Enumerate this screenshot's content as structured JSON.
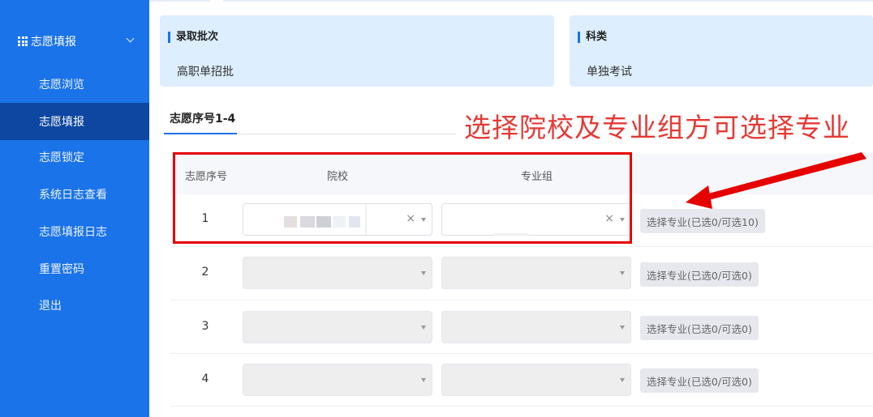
{
  "sidebar": {
    "header_label": "志愿填报",
    "items": [
      {
        "label": "志愿浏览"
      },
      {
        "label": "志愿填报"
      },
      {
        "label": "志愿锁定"
      },
      {
        "label": "系统日志查看"
      },
      {
        "label": "志愿填报日志"
      },
      {
        "label": "重置密码"
      },
      {
        "label": "退出"
      }
    ],
    "active_index": 1
  },
  "info_cards": [
    {
      "title": "录取批次",
      "value": "高职单招批"
    },
    {
      "title": "科类",
      "value": "单独考试"
    }
  ],
  "tab": {
    "label": "志愿序号1-4"
  },
  "annotation": {
    "text": "选择院校及专业组方可选择专业"
  },
  "table": {
    "headers": {
      "index": "志愿序号",
      "school": "院校",
      "group": "专业组"
    },
    "rows": [
      {
        "index": "1",
        "button_label": "选择专业(已选0/可选10)",
        "enabled": true
      },
      {
        "index": "2",
        "button_label": "选择专业(已选0/可选0)",
        "enabled": false
      },
      {
        "index": "3",
        "button_label": "选择专业(已选0/可选0)",
        "enabled": false
      },
      {
        "index": "4",
        "button_label": "选择专业(已选0/可选0)",
        "enabled": false
      }
    ],
    "clear_glyph": "×"
  },
  "colors": {
    "sidebar_bg": "#1a73e8",
    "sidebar_active": "#0d47a1",
    "card_bg": "#ddeefe",
    "annotation": "#e53935",
    "highlight_box": "#e60000"
  }
}
